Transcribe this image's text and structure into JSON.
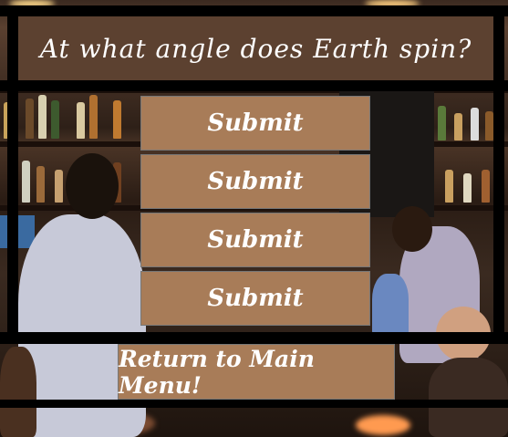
{
  "question": {
    "text": "At what angle does Earth spin?"
  },
  "answers": [
    {
      "label": "Submit"
    },
    {
      "label": "Submit"
    },
    {
      "label": "Submit"
    },
    {
      "label": "Submit"
    }
  ],
  "return_button": {
    "label": "Return to Main Menu!"
  },
  "colors": {
    "title_background": "#5c4130",
    "button_background": "#a87c58",
    "frame": "#000000",
    "text": "#ffffff"
  }
}
